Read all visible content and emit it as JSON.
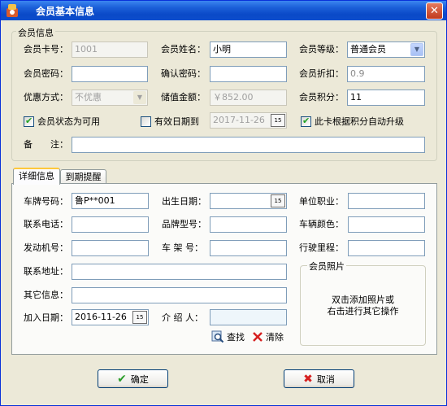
{
  "window": {
    "title": "会员基本信息",
    "close": "✕"
  },
  "member_info": {
    "legend": "会员信息",
    "card_no": {
      "label": "会员卡号：",
      "value": "1001"
    },
    "name": {
      "label": "会员姓名：",
      "value": "小明"
    },
    "level": {
      "label": "会员等级：",
      "value": "普通会员"
    },
    "password": {
      "label": "会员密码：",
      "value": ""
    },
    "confirm_password": {
      "label": "确认密码：",
      "value": ""
    },
    "discount": {
      "label": "会员折扣：",
      "value": "0.9"
    },
    "benefit": {
      "label": "优惠方式：",
      "value": "不优惠"
    },
    "balance": {
      "label": "储值金额：",
      "value": "￥852.00"
    },
    "points": {
      "label": "会员积分：",
      "value": "11"
    },
    "status_check": "会员状态为可用",
    "expiry_check": "有效日期到",
    "expiry_date": "2017-11-26",
    "auto_upgrade_check": "此卡根据积分自动升级",
    "remark": {
      "label": "备　　注：",
      "value": ""
    }
  },
  "tabs": [
    {
      "label": "详细信息"
    },
    {
      "label": "到期提醒"
    }
  ],
  "detail": {
    "plate": {
      "label": "车牌号码：",
      "value": "鲁P**001"
    },
    "birthday": {
      "label": "出生日期：",
      "value": ""
    },
    "occupation": {
      "label": "单位职业：",
      "value": ""
    },
    "phone": {
      "label": "联系电话：",
      "value": ""
    },
    "model": {
      "label": "品牌型号：",
      "value": ""
    },
    "color": {
      "label": "车辆颜色：",
      "value": ""
    },
    "engine": {
      "label": "发动机号：",
      "value": ""
    },
    "frame": {
      "label": "车 架 号：",
      "value": ""
    },
    "mileage": {
      "label": "行驶里程：",
      "value": ""
    },
    "address": {
      "label": "联系地址：",
      "value": ""
    },
    "other": {
      "label": "其它信息：",
      "value": ""
    },
    "join_date": {
      "label": "加入日期：",
      "value": "2016-11-26"
    },
    "referrer": {
      "label": "介 绍 人：",
      "value": ""
    },
    "photo": {
      "legend": "会员照片",
      "line1": "双击添加照片或",
      "line2": "右击进行其它操作"
    },
    "search": "查找",
    "clear": "清除"
  },
  "calendar_icon": "15",
  "buttons": {
    "ok": "确定",
    "cancel": "取消"
  },
  "icons": [
    "app-icon",
    "close-icon",
    "dropdown-arrow-icon",
    "calendar-icon",
    "checkmark-icon",
    "search-icon",
    "clear-x-icon"
  ]
}
